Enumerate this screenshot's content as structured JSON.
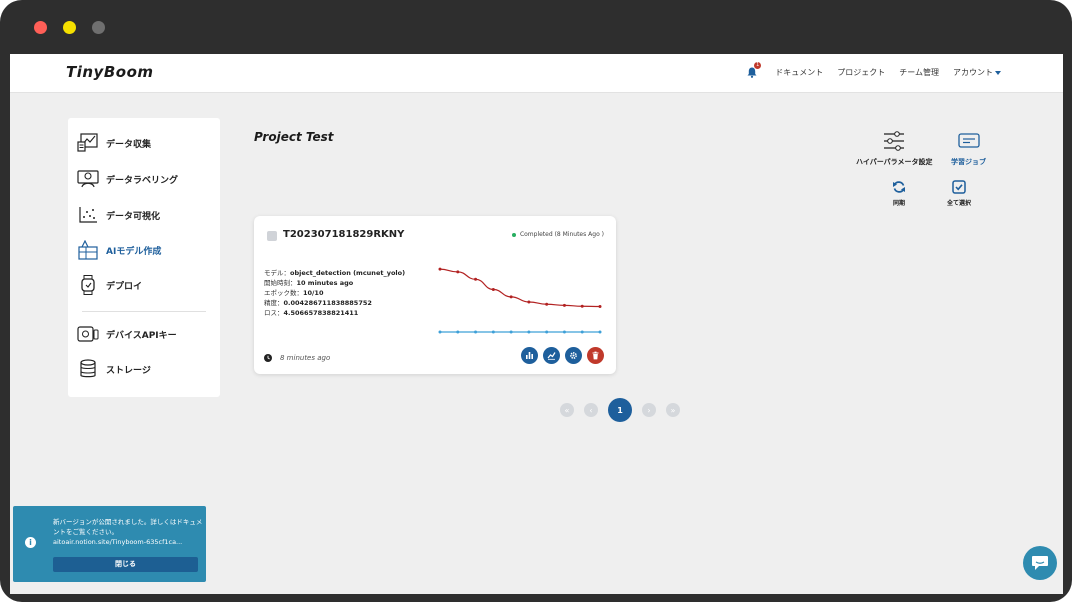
{
  "window": {
    "controls": [
      {
        "name": "close",
        "color": "#ff5f57"
      },
      {
        "name": "minimize",
        "color": "#f5e000"
      },
      {
        "name": "maximize",
        "color": "#6f6f6f"
      }
    ]
  },
  "header": {
    "logo": "TinyBoom",
    "notification_count": "1",
    "nav": [
      "ドキュメント",
      "プロジェクト",
      "チーム管理"
    ],
    "account_label": "アカウント"
  },
  "sidebar": {
    "items": [
      {
        "label": "データ収集",
        "icon": "data-collection-icon"
      },
      {
        "label": "データラベリング",
        "icon": "data-labeling-icon"
      },
      {
        "label": "データ可視化",
        "icon": "scatter-plot-icon"
      },
      {
        "label": "AIモデル作成",
        "icon": "model-build-icon",
        "active": true
      },
      {
        "label": "デプロイ",
        "icon": "smartwatch-icon"
      },
      {
        "label": "デバイスAPIキー",
        "icon": "device-key-icon"
      },
      {
        "label": "ストレージ",
        "icon": "database-icon"
      }
    ]
  },
  "main": {
    "title": "Project Test",
    "tools": {
      "hyperparams": "ハイパーパラメータ設定",
      "training_job": "学習ジョブ",
      "sync": "同期",
      "select_all": "全て選択"
    },
    "job_card": {
      "id": "T202307181829RKNY",
      "status": "Completed (8 Minutes Ago )",
      "model_label": "モデル：",
      "model_value": "object_detection (mcunet_yolo)",
      "start_label": "開始時刻：",
      "start_value": "10 minutes ago",
      "epoch_label": "エポック数：",
      "epoch_value": "10/10",
      "accuracy_label": "精度：",
      "accuracy_value": "0.004286711838885752",
      "loss_label": "ロス：",
      "loss_value": "4.506657838821411",
      "time_ago": "8 minutes ago"
    }
  },
  "chart_data": {
    "type": "line",
    "x": [
      1,
      2,
      3,
      4,
      5,
      6,
      7,
      8,
      9,
      10
    ],
    "series": [
      {
        "color": "#b22222",
        "values": [
          11.1,
          10.6,
          9.3,
          7.5,
          6.2,
          5.3,
          4.9,
          4.7,
          4.55,
          4.5
        ]
      },
      {
        "color": "#3ea0d8",
        "values": [
          0.0043,
          0.0043,
          0.0043,
          0.0043,
          0.0043,
          0.0043,
          0.0043,
          0.0043,
          0.0043,
          0.0043
        ]
      }
    ],
    "ylim": [
      0,
      12
    ],
    "grid": false
  },
  "pagination": {
    "current": "1"
  },
  "toast": {
    "message": "新バージョンが公開されました。詳しくはドキュメントをご覧ください。",
    "link": "aitoair.notion.site/Tinyboom-635cf1ca...",
    "close_label": "閉じる"
  },
  "colors": {
    "accent": "#1e5f9c",
    "danger": "#c0392b",
    "toast": "#2e8bb0"
  }
}
